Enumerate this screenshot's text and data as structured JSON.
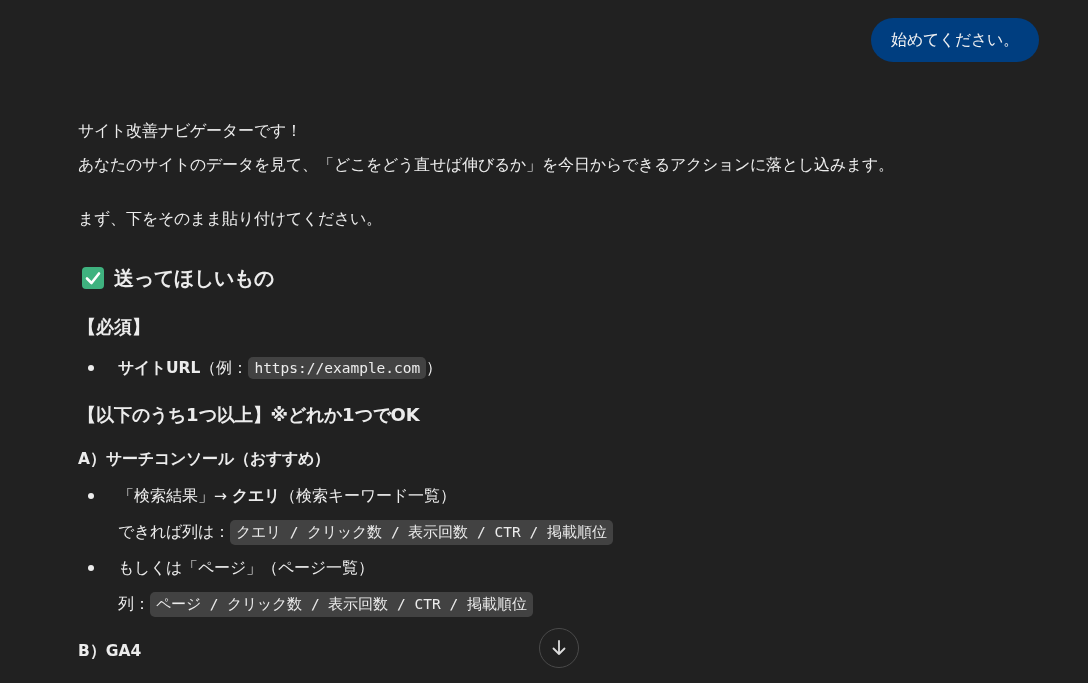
{
  "user_message": {
    "text": "始めてください。"
  },
  "assistant_message": {
    "blocks": [
      {
        "kind": "paragraph",
        "lines": [
          "サイト改善ナビゲーターです！",
          "あなたのサイトのデータを見て、「どこをどう直せば伸びるか」を今日からできるアクションに落とし込みます。"
        ]
      },
      {
        "kind": "paragraph",
        "lines": [
          "まず、下をそのまま貼り付けてください。"
        ]
      },
      {
        "kind": "heading",
        "text": "送ってほしいもの"
      },
      {
        "kind": "section",
        "text": "【必須】"
      },
      {
        "kind": "list",
        "items": [
          {
            "text": "**サイトURL**（例：",
            "code": "https://example.com",
            "after": "）"
          }
        ]
      },
      {
        "kind": "section",
        "text": "【以下のうち1つ以上】※どれか1つでOK"
      },
      {
        "kind": "subheading",
        "text": "A）サーチコンソール（おすすめ）"
      },
      {
        "kind": "list",
        "items": [
          {
            "text": "「検索結果」→ **クエリ**（検索キーワード一覧）",
            "sub_label": "できれば列は：",
            "code": "クエリ / クリック数 / 表示回数 / CTR / 掲載順位"
          },
          {
            "text": "もしくは「ページ」（ページ一覧）",
            "sub_label": "列：",
            "code": "ページ / クリック数 / 表示回数 / CTR / 掲載順位"
          }
        ]
      },
      {
        "kind": "subheading",
        "text": "B）GA4"
      }
    ]
  }
}
